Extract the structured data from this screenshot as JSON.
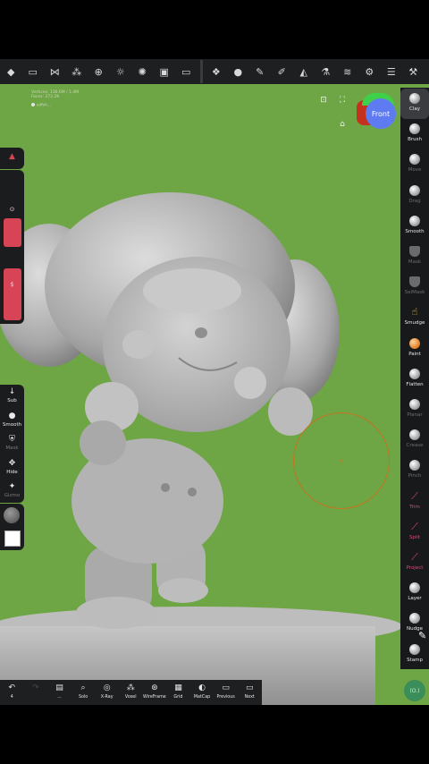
{
  "topbar": {
    "icons": [
      "brand-icon",
      "folder-icon",
      "share-icon",
      "scene-icon",
      "grid-icon",
      "light-icon",
      "material-icon",
      "image-icon",
      "video-icon",
      "layers-cube-icon",
      "sphere-icon",
      "brush-icon",
      "picker-icon",
      "mirror-icon",
      "flask-icon",
      "stack-icon",
      "settings-icon",
      "sliders-icon",
      "tools-icon"
    ]
  },
  "info": {
    "line1": "Vertices: 136.6M / 1.4M",
    "line2": "Faces: 272.2K",
    "active": "sdfsh..."
  },
  "gizmo": {
    "label": "Front"
  },
  "right_tools": [
    {
      "label": "Clay",
      "style": "normal",
      "active": true
    },
    {
      "label": "Brush",
      "style": "normal"
    },
    {
      "label": "Move",
      "style": "dim"
    },
    {
      "label": "Drag",
      "style": "dim"
    },
    {
      "label": "Smooth",
      "style": "normal"
    },
    {
      "label": "Mask",
      "style": "dim",
      "shape": "shield"
    },
    {
      "label": "SelMask",
      "style": "dim",
      "shape": "shield"
    },
    {
      "label": "Smudge",
      "style": "normal",
      "shape": "yellow"
    },
    {
      "label": "Paint",
      "style": "normal",
      "shape": "orange"
    },
    {
      "label": "Flatten",
      "style": "normal"
    },
    {
      "label": "Planar",
      "style": "dim"
    },
    {
      "label": "Crease",
      "style": "dim"
    },
    {
      "label": "Pinch",
      "style": "dim"
    },
    {
      "label": "Trim",
      "style": "red",
      "shape": "red"
    },
    {
      "label": "Split",
      "style": "red",
      "shape": "red"
    },
    {
      "label": "Project",
      "style": "red",
      "shape": "red"
    },
    {
      "label": "Layer",
      "style": "normal"
    },
    {
      "label": "Nudge",
      "style": "normal"
    },
    {
      "label": "Stamp",
      "style": "normal"
    }
  ],
  "left": {
    "slider1_label": "⊙",
    "slider2_label": "$",
    "tools": [
      {
        "label": "Sub",
        "icon": "↓"
      },
      {
        "label": "Smooth",
        "icon": "●"
      },
      {
        "label": "Mask",
        "icon": "⛨",
        "dim": true
      },
      {
        "label": "Hide",
        "icon": "✥"
      },
      {
        "label": "Gizmo",
        "icon": "✦",
        "dim": true
      }
    ]
  },
  "bottom_tools": [
    {
      "label": "↶",
      "sub": "4"
    },
    {
      "label": "↷",
      "sub": "",
      "dim": true
    },
    {
      "label": "▤",
      "sub": "..."
    },
    {
      "label": "⌕",
      "sub": "Solo"
    },
    {
      "label": "◎",
      "sub": "X-Ray"
    },
    {
      "label": "⁂",
      "sub": "Voxel"
    },
    {
      "label": "⊛",
      "sub": "WireFrame"
    },
    {
      "label": "▦",
      "sub": "Grid"
    },
    {
      "label": "◐",
      "sub": "MatCap"
    },
    {
      "label": "▭",
      "sub": "Previous"
    },
    {
      "label": "▭",
      "sub": "Next"
    }
  ],
  "fab": {
    "label": "(O.)"
  },
  "colors": {
    "viewport": "#6ea545",
    "accent_red": "#d74456",
    "brush_ring": "#c6741e"
  }
}
